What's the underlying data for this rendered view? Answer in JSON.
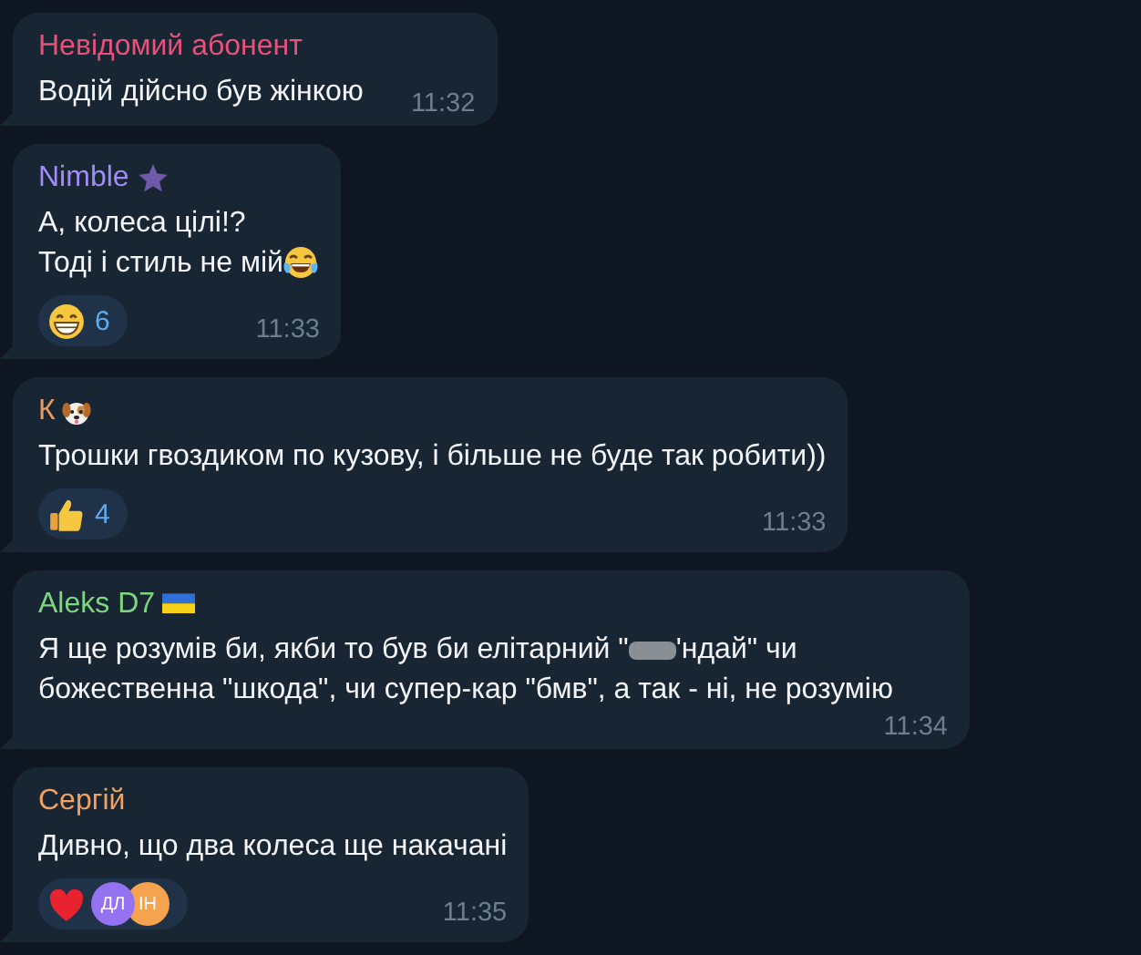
{
  "messages": [
    {
      "sender": {
        "name": "Невідомий абонент",
        "color": "#e9507a"
      },
      "text": [
        {
          "kind": "text",
          "text": "Водій дійсно був жінкою"
        }
      ],
      "time": "11:32"
    },
    {
      "sender": {
        "name": "Nimble",
        "color": "#a08cf4",
        "badge": {
          "kind": "star"
        }
      },
      "text": [
        {
          "kind": "text",
          "text": "А, колеса цілі!?"
        },
        {
          "kind": "break"
        },
        {
          "kind": "text",
          "text": "Тоді і стиль не мій"
        },
        {
          "kind": "laugh"
        }
      ],
      "reactions": [
        {
          "kind": "grin",
          "count": "6"
        }
      ],
      "time": "11:33"
    },
    {
      "sender": {
        "name": "К",
        "color": "#ee9a5c",
        "badge": {
          "kind": "dog"
        }
      },
      "text": [
        {
          "kind": "text",
          "text": "Трошки гвоздиком по кузову, і більше не буде так робити))"
        }
      ],
      "reactions": [
        {
          "kind": "thumbs",
          "count": "4"
        }
      ],
      "time": "11:33"
    },
    {
      "sender": {
        "name": "Aleks D7",
        "color": "#7fd67f",
        "badge": {
          "kind": "flag"
        }
      },
      "text": [
        {
          "kind": "text",
          "text": "Я ще розумів би, якби то був би елітарний \""
        },
        {
          "kind": "censored"
        },
        {
          "kind": "text",
          "text": "'ндай\" чи божественна \"шкода\", чи супер-кар \"бмв\", а так - ні, не розумію"
        }
      ],
      "time": "11:34"
    },
    {
      "sender": {
        "name": "Сергій",
        "color": "#f0a060"
      },
      "text": [
        {
          "kind": "text",
          "text": "Дивно, що два колеса ще накачані"
        }
      ],
      "reactions": [
        {
          "kind": "heart",
          "avatars": [
            {
              "initials": "ДЛ",
              "color": "#9572f0"
            },
            {
              "initials": "ІН",
              "color": "#f5a34e"
            }
          ]
        }
      ],
      "time": "11:35"
    }
  ]
}
